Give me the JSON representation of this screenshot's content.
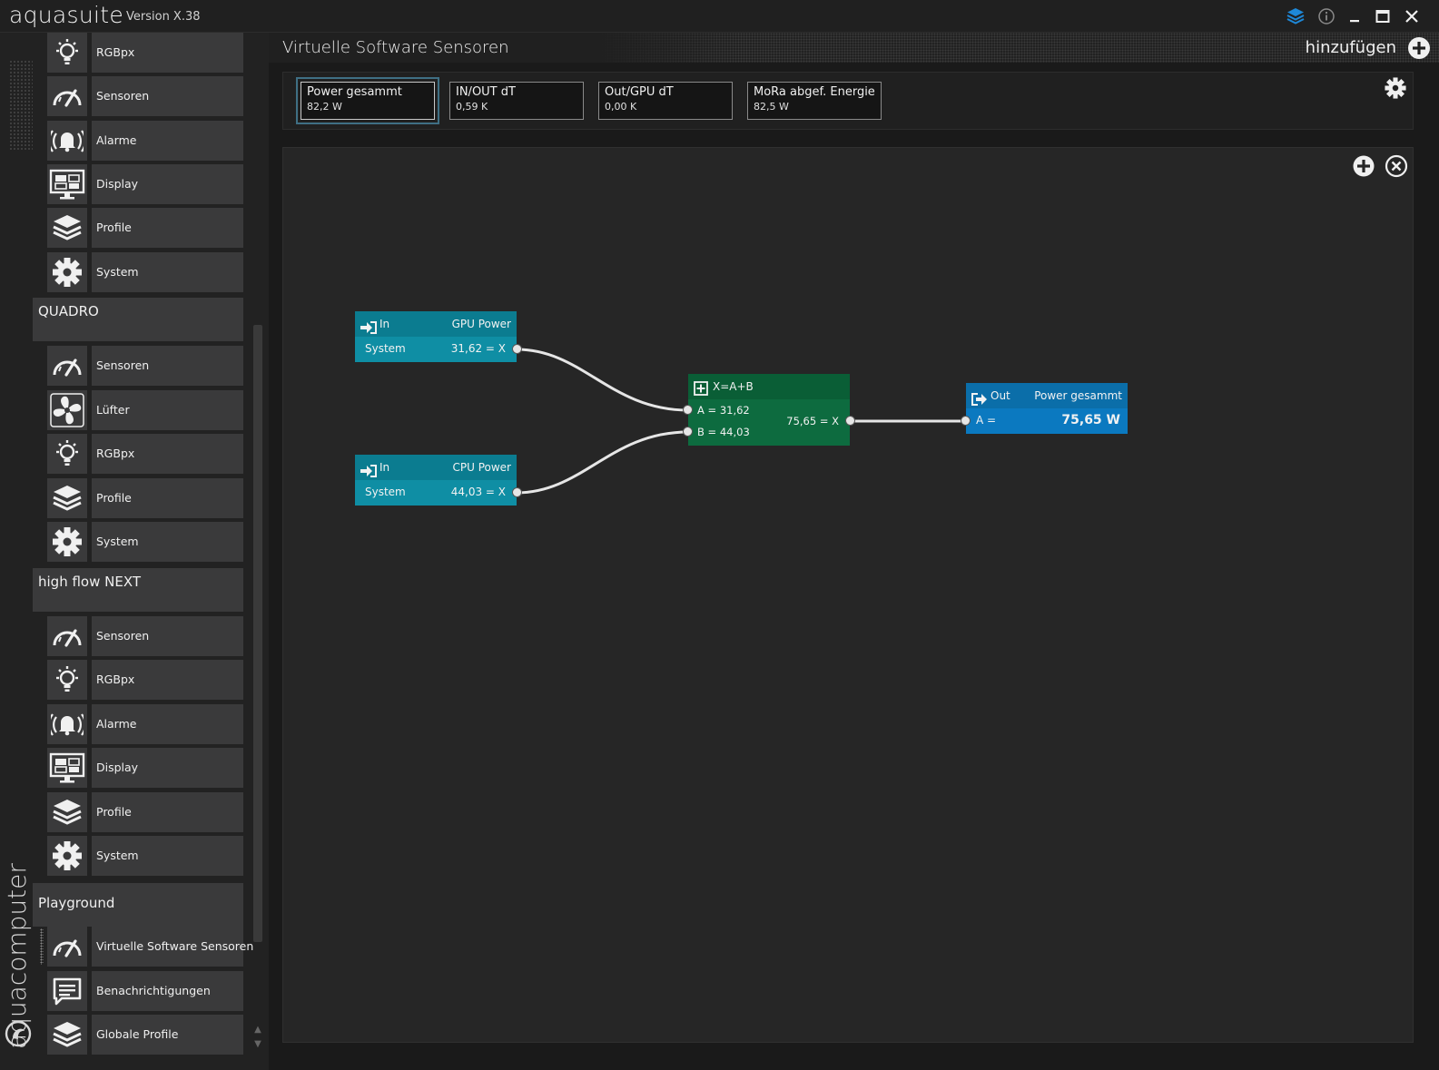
{
  "app": {
    "name": "aquasuite",
    "version": "Version X.38"
  },
  "brand": {
    "vertical": "aquacomputer"
  },
  "sidebar": {
    "top_items": [
      {
        "label": "RGBpx",
        "icon": "bulb-icon"
      },
      {
        "label": "Sensoren",
        "icon": "gauge-icon"
      },
      {
        "label": "Alarme",
        "icon": "alarm-bell-icon"
      },
      {
        "label": "Display",
        "icon": "display-icon"
      },
      {
        "label": "Profile",
        "icon": "layers-icon"
      },
      {
        "label": "System",
        "icon": "gear-icon"
      }
    ],
    "groups": [
      {
        "title": "QUADRO",
        "items": [
          {
            "label": "Sensoren",
            "icon": "gauge-icon"
          },
          {
            "label": "Lüfter",
            "icon": "fan-icon"
          },
          {
            "label": "RGBpx",
            "icon": "bulb-icon"
          },
          {
            "label": "Profile",
            "icon": "layers-icon"
          },
          {
            "label": "System",
            "icon": "gear-icon"
          }
        ]
      },
      {
        "title": "high flow NEXT",
        "items": [
          {
            "label": "Sensoren",
            "icon": "gauge-icon"
          },
          {
            "label": "RGBpx",
            "icon": "bulb-icon"
          },
          {
            "label": "Alarme",
            "icon": "alarm-bell-icon"
          },
          {
            "label": "Display",
            "icon": "display-icon"
          },
          {
            "label": "Profile",
            "icon": "layers-icon"
          },
          {
            "label": "System",
            "icon": "gear-icon"
          }
        ]
      },
      {
        "title": "Playground",
        "items": [
          {
            "label": "Virtuelle Software Sensoren",
            "icon": "gauge-icon"
          },
          {
            "label": "Benachrichtigungen",
            "icon": "message-icon"
          },
          {
            "label": "Globale Profile",
            "icon": "layers-icon"
          }
        ]
      }
    ]
  },
  "main": {
    "title": "Virtuelle Software Sensoren",
    "add_label": "hinzufügen"
  },
  "sensors": [
    {
      "title": "Power gesammt",
      "value": "82,2 W"
    },
    {
      "title": "IN/OUT dT",
      "value": "0,59 K"
    },
    {
      "title": "Out/GPU dT",
      "value": "0,00 K"
    },
    {
      "title": "MoRa abgef. Energie",
      "value": "82,5 W"
    }
  ],
  "nodes": {
    "gpu_in": {
      "kind": "In",
      "source": "GPU Power",
      "group": "System",
      "value": "31,62 = X"
    },
    "cpu_in": {
      "kind": "In",
      "source": "CPU Power",
      "group": "System",
      "value": "44,03 = X"
    },
    "add": {
      "formula": "X=A+B",
      "a": "A = 31,62",
      "b": "B = 44,03",
      "result": "75,65 = X"
    },
    "out": {
      "kind": "Out",
      "target": "Power gesammt",
      "a": "A =",
      "value": "75,65 W"
    }
  },
  "colors": {
    "input_node": "#0f8da3",
    "operator_node": "#0d6b3f",
    "output_node": "#0b79c0",
    "accent": "#1e88d8"
  }
}
